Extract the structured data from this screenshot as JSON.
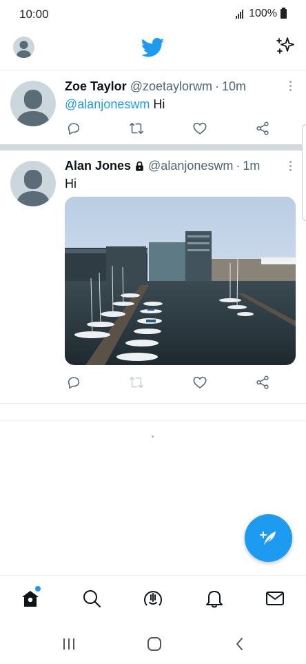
{
  "status_bar": {
    "time": "10:00",
    "battery_text": "100%",
    "icons": [
      "signal-icon",
      "battery-icon"
    ]
  },
  "header": {
    "icons": [
      "profile-avatar",
      "twitter-logo-icon",
      "sparkle-icon"
    ]
  },
  "tweets": [
    {
      "name": "Zoe Taylor",
      "handle": "@zoetaylorwm",
      "separator": "·",
      "time": "10m",
      "mention": "@alanjoneswm",
      "text": "Hi",
      "protected": false
    },
    {
      "name": "Alan Jones",
      "handle": "@alanjoneswm",
      "separator": "·",
      "time": "1m",
      "mention": "",
      "text": "Hi",
      "protected": true,
      "has_photo": true
    }
  ],
  "tweet_actions": [
    "reply-icon",
    "retweet-icon",
    "like-icon",
    "share-icon"
  ],
  "tab_bar": {
    "items": [
      "home-icon",
      "search-icon",
      "spaces-icon",
      "notifications-icon",
      "messages-icon"
    ],
    "active": "home-icon",
    "home_has_new_dot": true
  },
  "fab": {
    "icon": "compose-tweet-icon"
  },
  "colors": {
    "accent": "#1d9bf0",
    "text": "#0f1419",
    "secondary": "#536471",
    "separator": "#cfd9de"
  }
}
